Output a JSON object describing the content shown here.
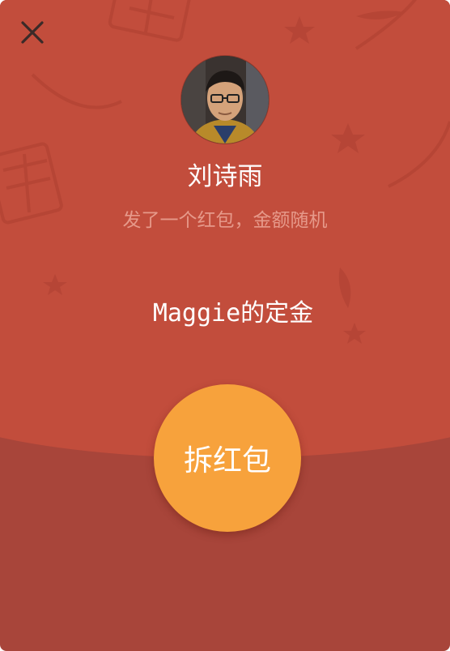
{
  "sender": {
    "name": "刘诗雨",
    "avatar_icon": "person-photo-avatar"
  },
  "subtitle": "发了一个红包，金额随机",
  "message": "Maggie的定金",
  "open_button": {
    "label": "拆红包"
  },
  "close_icon": "close-x-icon",
  "colors": {
    "top_background": "#c24d3c",
    "bottom_background": "#a8453a",
    "button": "#f7a23c",
    "subtitle_text": "#e6998a",
    "text": "#ffffff"
  }
}
